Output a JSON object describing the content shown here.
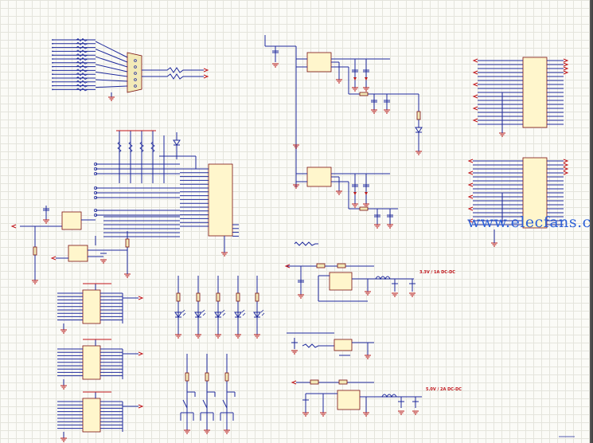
{
  "watermark": "www.elecfans.com",
  "labels": {
    "dcdc_33": "3.3V / 1A DC-DC",
    "dcdc_50": "5.0V / 2A DC-DC"
  },
  "colors": {
    "wire": "#1f2a9c",
    "net_label": "#c0141a",
    "component_fill": "#f2e9b8",
    "component_border": "#7a1010",
    "grid": "#e4e4dc",
    "watermark": "#2f62d8"
  }
}
